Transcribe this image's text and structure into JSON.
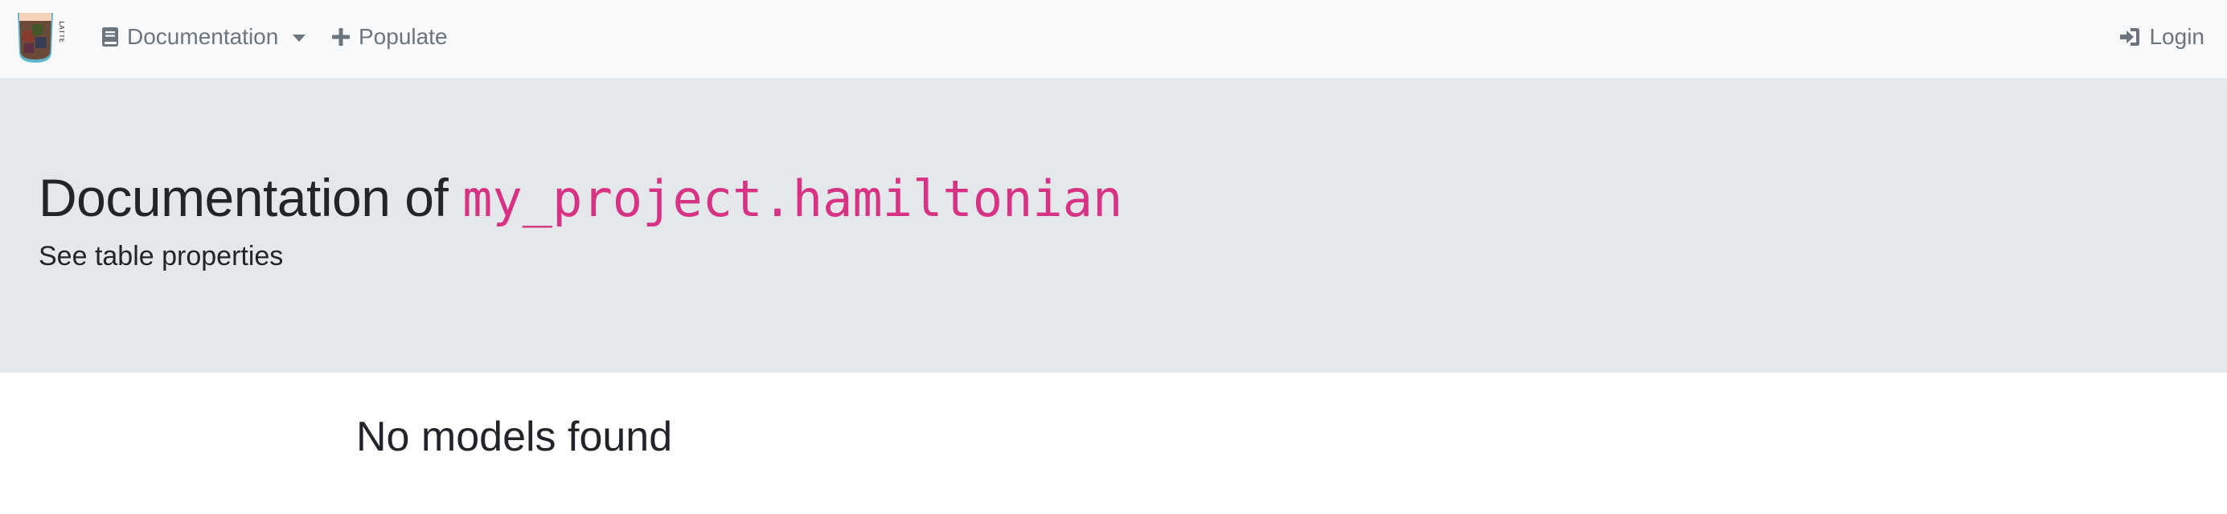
{
  "navbar": {
    "brand": {
      "name": "logo",
      "text": "LATTE"
    },
    "items": [
      {
        "label": "Documentation",
        "icon": "book-icon",
        "has_dropdown": true
      },
      {
        "label": "Populate",
        "icon": "plus-icon"
      }
    ],
    "login": {
      "label": "Login",
      "icon": "sign-in-icon"
    }
  },
  "jumbotron": {
    "title_prefix": "Documentation of",
    "title_code": "my_project.hamiltonian",
    "subtitle_link": "See table properties"
  },
  "main": {
    "heading": "No models found"
  },
  "colors": {
    "navbar_bg": "#f8f9fa",
    "jumbotron_bg": "#e5e8eb",
    "code": "#d63384",
    "nav_text": "#6c757d",
    "text": "#212529"
  }
}
